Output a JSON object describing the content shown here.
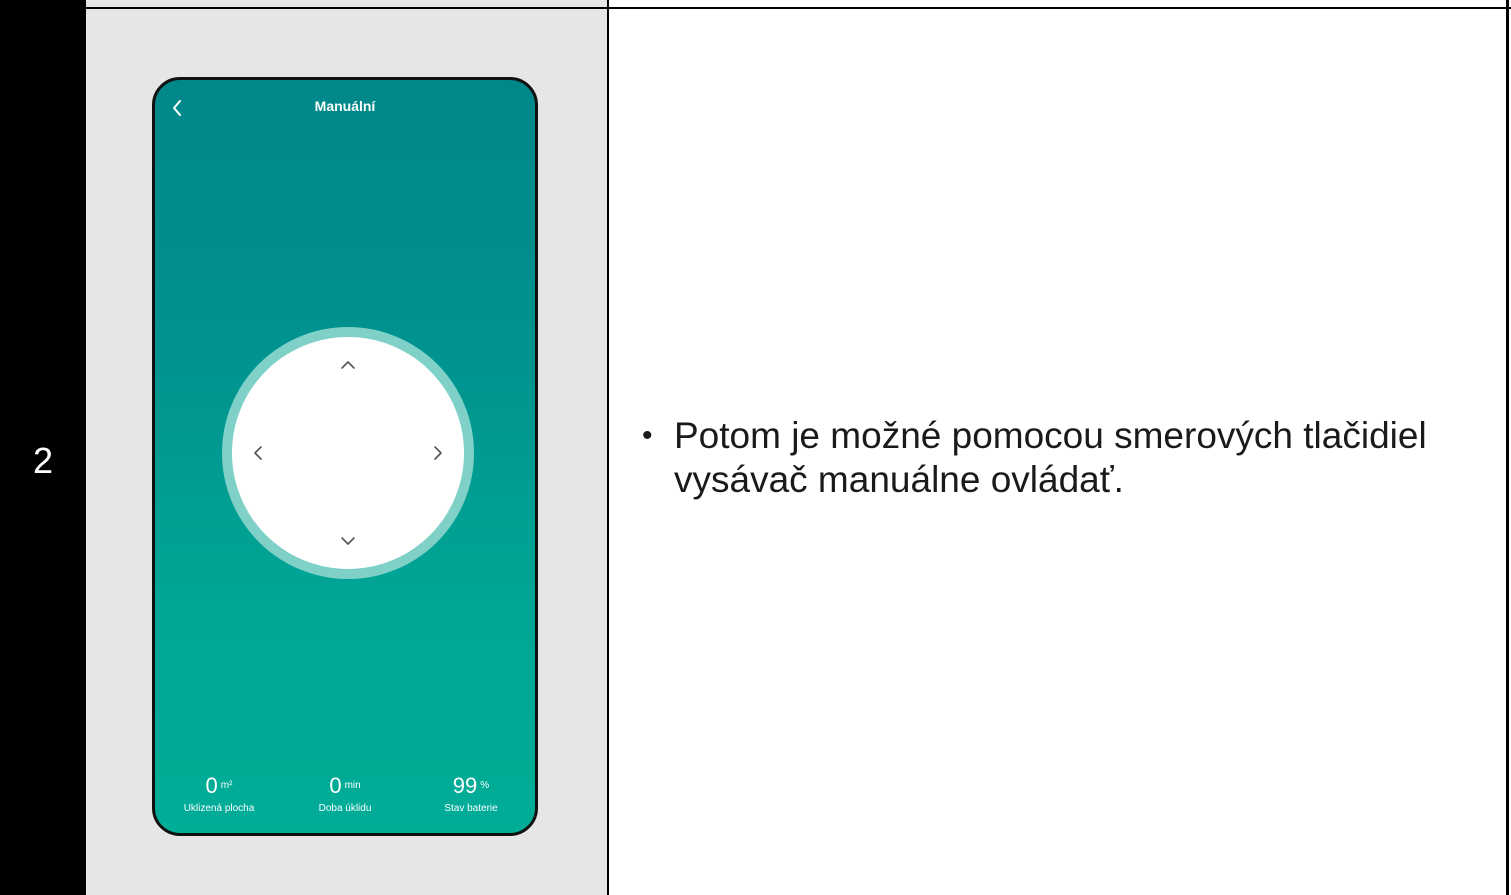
{
  "step": {
    "number": "2"
  },
  "phone": {
    "title": "Manuální",
    "icons": {
      "back": "chevron-left-icon",
      "up": "chevron-up-icon",
      "down": "chevron-down-icon",
      "left": "chevron-left-icon",
      "right": "chevron-right-icon"
    },
    "stats": [
      {
        "value": "0",
        "unit": "m²",
        "label": "Uklizená plocha"
      },
      {
        "value": "0",
        "unit": "min",
        "label": "Doba úklidu"
      },
      {
        "value": "99",
        "unit": "%",
        "label": "Stav baterie"
      }
    ],
    "colors": {
      "gradient_top": "#00878a",
      "gradient_bottom": "#00ad97",
      "dpad_ring": "#7fd1c8",
      "dpad_fill": "#ffffff"
    }
  },
  "instruction": {
    "bullet": "•",
    "text": "Potom je možné pomocou smerových tlačidiel vysávač manuálne ovládať."
  }
}
